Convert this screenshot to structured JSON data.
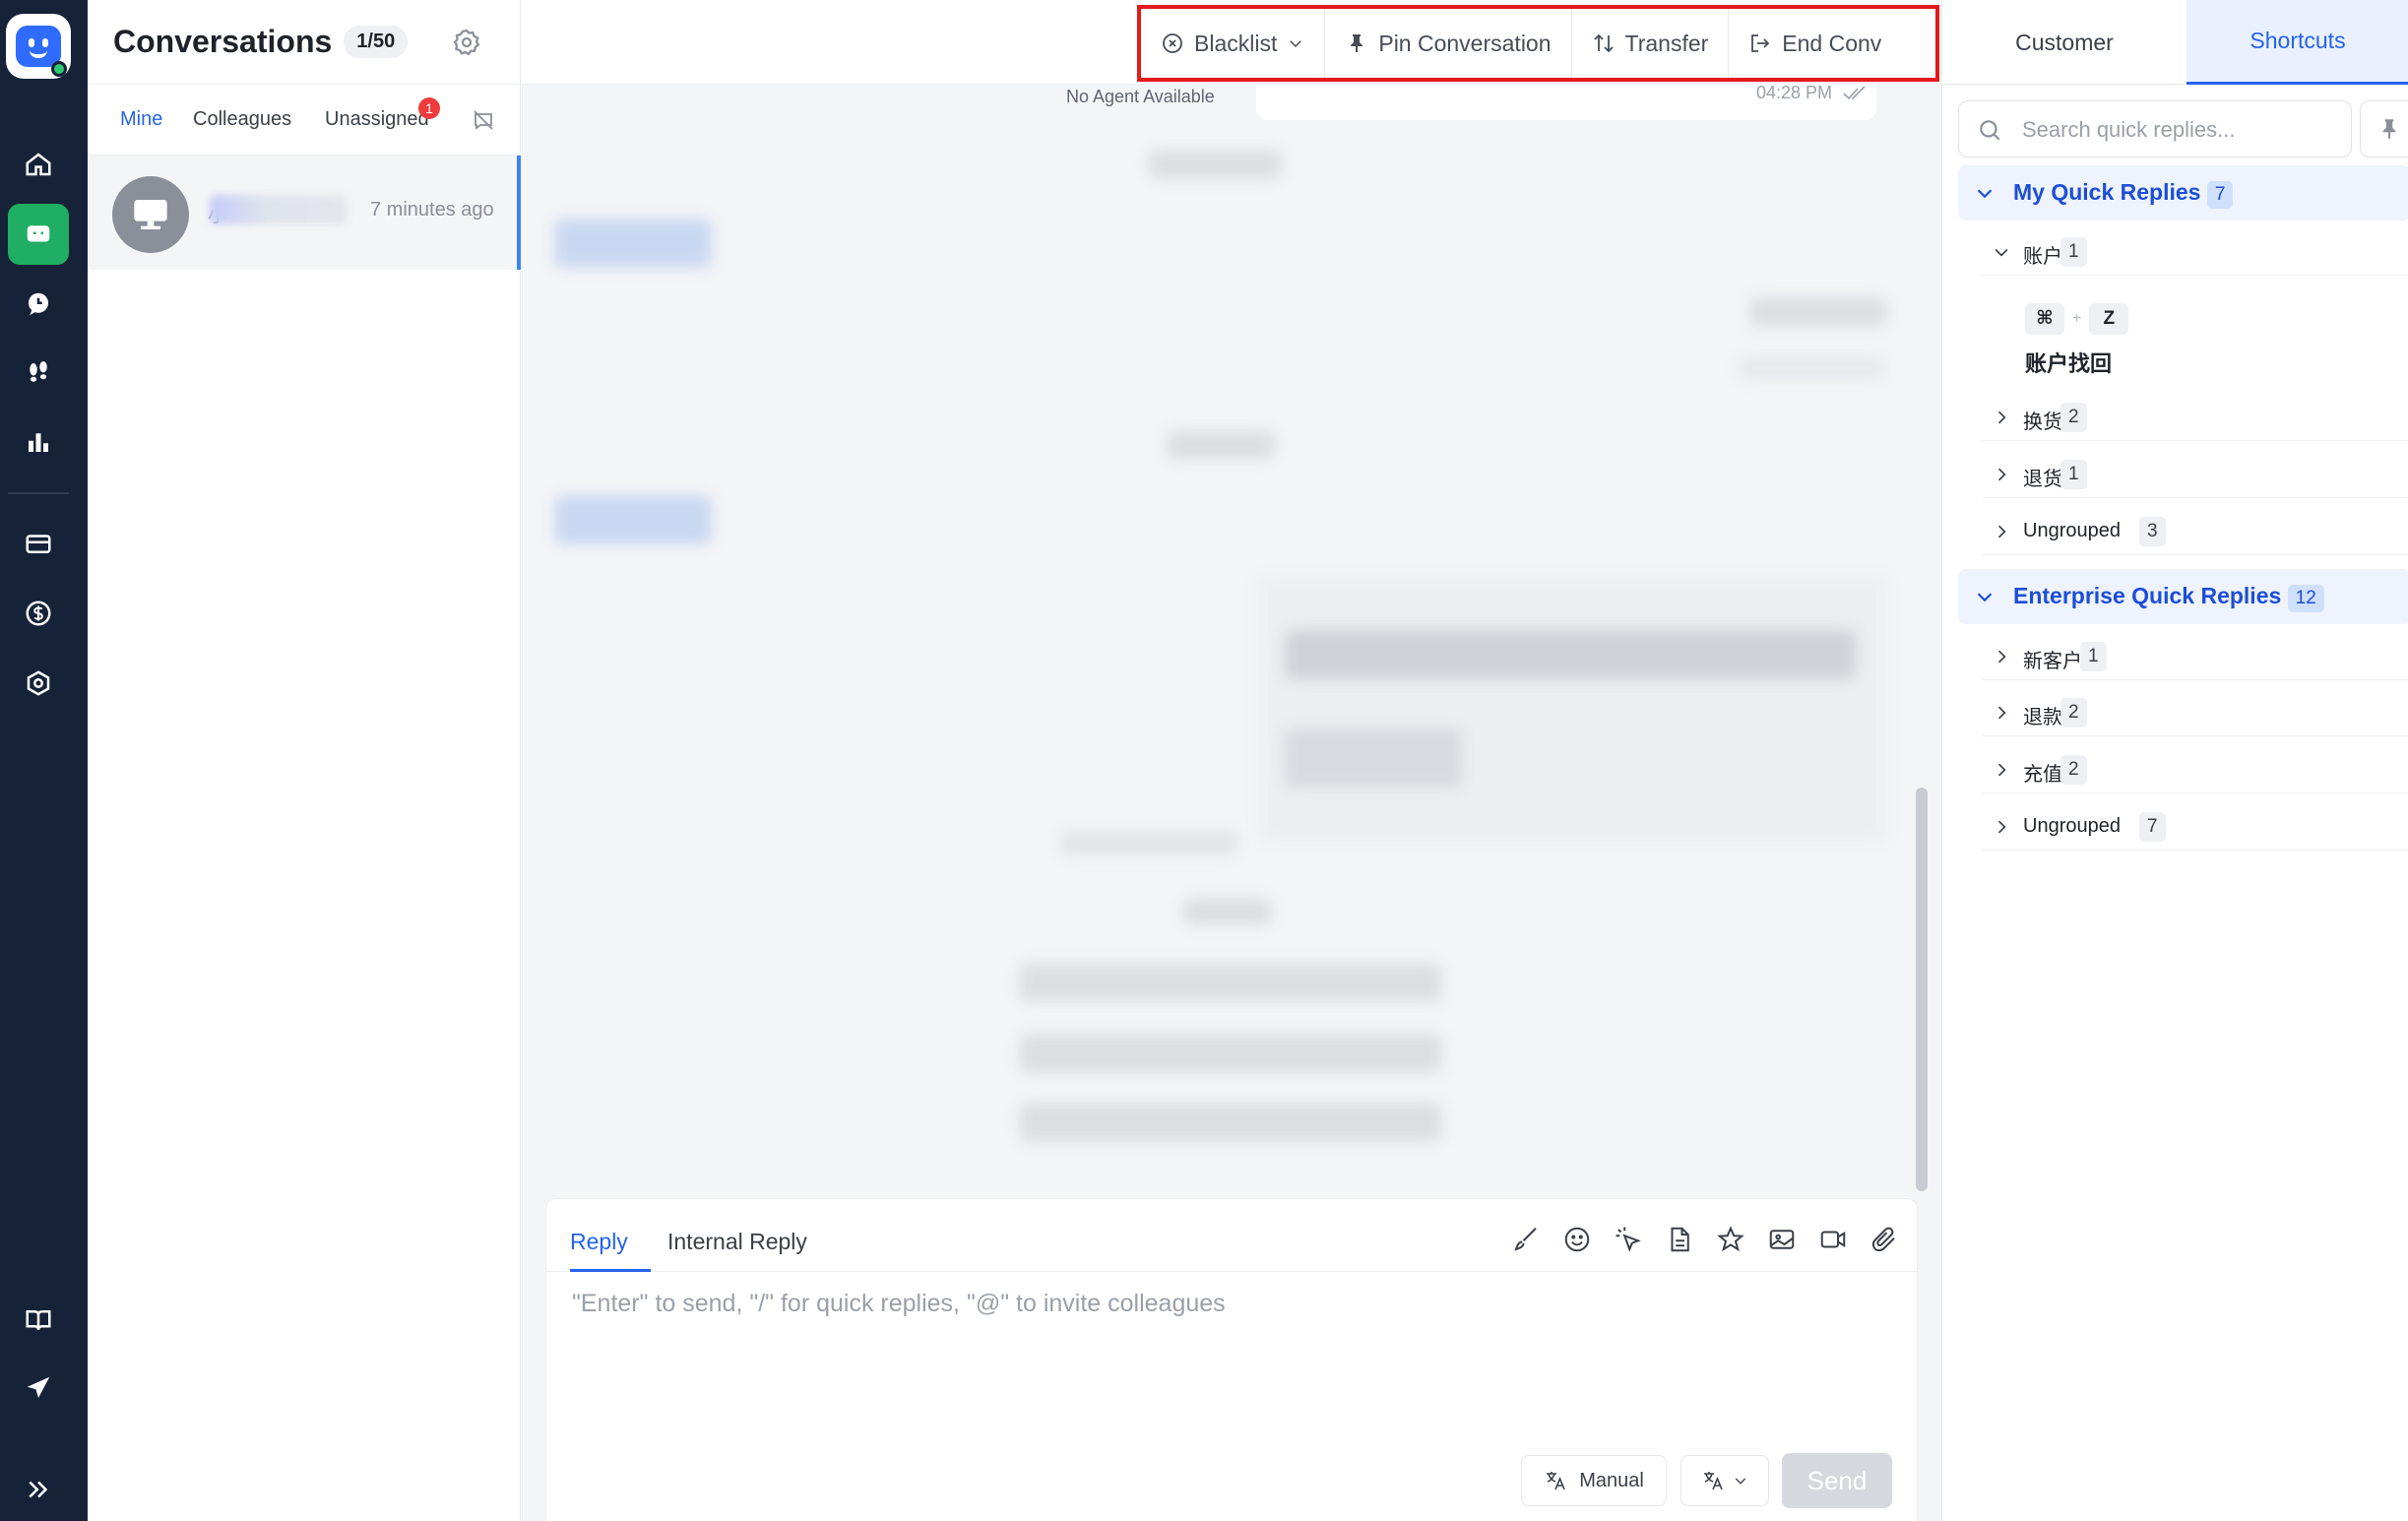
{
  "list": {
    "title": "Conversations",
    "count": "1/50",
    "tabs": [
      "Mine",
      "Colleagues",
      "Unassigned"
    ],
    "unassigned_badge": "1",
    "conversation": {
      "name_prefix": "小",
      "time": "7 minutes ago"
    }
  },
  "toolbar": {
    "blacklist": "Blacklist",
    "pin": "Pin Conversation",
    "transfer": "Transfer",
    "end": "End Conv"
  },
  "chat": {
    "no_agent": "No Agent Available",
    "message_time": "04:28 PM"
  },
  "composer": {
    "tab_reply": "Reply",
    "tab_internal": "Internal Reply",
    "placeholder": "\"Enter\" to send, \"/\" for quick replies, \"@\" to invite colleagues",
    "manual_label": "Manual",
    "send_label": "Send"
  },
  "right": {
    "tab_customer": "Customer",
    "tab_shortcuts": "Shortcuts",
    "search_placeholder": "Search quick replies...",
    "my_group": {
      "label": "My Quick Replies",
      "count": "7"
    },
    "my_items": [
      {
        "label": "账户",
        "count": "1"
      },
      {
        "label": "换货",
        "count": "2"
      },
      {
        "label": "退货",
        "count": "1"
      },
      {
        "label": "Ungrouped",
        "count": "3"
      }
    ],
    "reply": {
      "key1": "⌘",
      "plus": "+",
      "key2": "Z",
      "title": "账户找回"
    },
    "enterprise_group": {
      "label": "Enterprise Quick Replies",
      "count": "12"
    },
    "enterprise_items": [
      {
        "label": "新客户",
        "count": "1"
      },
      {
        "label": "退款",
        "count": "2"
      },
      {
        "label": "充值",
        "count": "2"
      },
      {
        "label": "Ungrouped",
        "count": "7"
      }
    ]
  },
  "colors": {
    "accent": "#2563eb",
    "rail": "#152238",
    "active_nav": "#1fae63",
    "highlight": "#e31a1a"
  }
}
